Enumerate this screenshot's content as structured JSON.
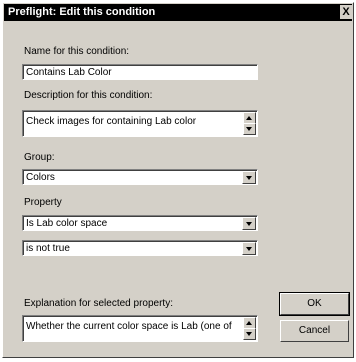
{
  "dialog": {
    "title": "Preflight: Edit this condition",
    "close_glyph": "X"
  },
  "name": {
    "label": "Name for this condition:",
    "value": "Contains Lab Color"
  },
  "description": {
    "label": "Description for this condition:",
    "value": "Check images for containing Lab color"
  },
  "group": {
    "label": "Group:",
    "selected": "Colors"
  },
  "property": {
    "label": "Property",
    "selected": "Is Lab color space",
    "operator_selected": "is not true"
  },
  "explanation": {
    "label": "Explanation for selected property:",
    "value": "Whether the current color space is Lab (one of"
  },
  "buttons": {
    "ok": "OK",
    "cancel": "Cancel"
  },
  "icons": {
    "close": "close-icon",
    "dropdown": "chevron-down-icon",
    "scroll_up": "arrow-up-icon",
    "scroll_down": "arrow-down-icon"
  }
}
